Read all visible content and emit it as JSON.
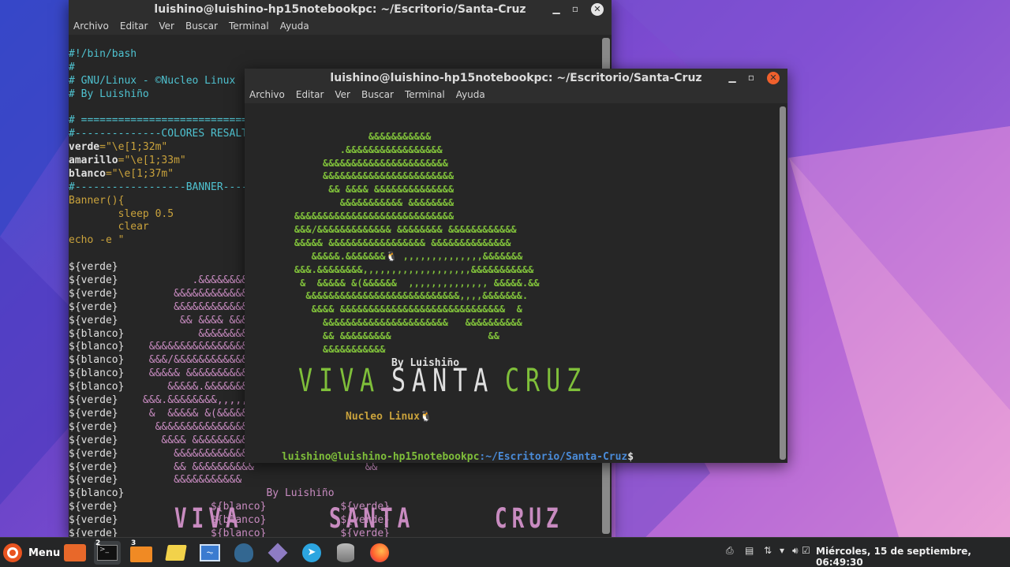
{
  "colors": {
    "accent": "#7fbf3a",
    "cyan": "#4fc2d0",
    "yellow": "#c9a23c",
    "pink": "#c88bc0",
    "prompt_blue": "#4a8bd8",
    "close_orange": "#f0602c"
  },
  "back_window": {
    "title": "luishino@luishino-hp15notebookpc: ~/Escritorio/Santa-Cruz",
    "menu": [
      "Archivo",
      "Editar",
      "Ver",
      "Buscar",
      "Terminal",
      "Ayuda"
    ],
    "lines": [
      "",
      "#!/bin/bash",
      "#",
      "# GNU/Linux - ©Nucleo Linux",
      "# By Luishiño",
      "",
      "# =====================================",
      "#--------------COLORES RESALTADOS",
      "verde=\"\\e[1;32m\"",
      "amarillo=\"\\e[1;33m\"",
      "blanco=\"\\e[1;37m\"",
      "#------------------BANNER-----",
      "Banner(){",
      "        sleep 0.5",
      "        clear",
      "echo -e \"",
      "",
      "${verde}",
      "${verde}            .&&&&&&&&&&&&",
      "${verde}         &&&&&&&&&&&&&&",
      "${verde}         &&&&&&&&&&&&&&",
      "${verde}          && &&&& &&&&",
      "${blanco}            &&&&&&&&&&&",
      "${blanco}    &&&&&&&&&&&&&&&&&&&&",
      "${blanco}    &&&/&&&&&&&&&&&&&&&&",
      "${blanco}    &&&&& &&&&&&&&&&&&&&",
      "${blanco}       &&&&&.&&&&&&&&&&&",
      "${verde}    &&&.&&&&&&&&,,,,,,,",
      "${verde}     &  &&&&& &(&&&&&&&",
      "${verde}      &&&&&&&&&&&&&&&&&&&",
      "${verde}       &&&& &&&&&&&&&&&&&",
      "${verde}         &&&&&&&&&&&&&&&&",
      "${verde}         && &&&&&&&&&&                  &&",
      "${verde}         &&&&&&&&&&&",
      "${blanco}                       By Luishiño",
      "${verde}               ${blanco}            ${verde}",
      "${verde}               ${blanco}            ${verde}",
      "${verde}               ${blanco}            ${verde}"
    ],
    "big_words": [
      "VIVA",
      "SANTA",
      "CRUZ"
    ]
  },
  "front_window": {
    "title": "luishino@luishino-hp15notebookpc: ~/Escritorio/Santa-Cruz",
    "menu": [
      "Archivo",
      "Editar",
      "Ver",
      "Buscar",
      "Terminal",
      "Ayuda"
    ],
    "art": [
      "",
      "",
      "                 &&&&&&&&&&&",
      "            .&&&&&&&&&&&&&&&&&",
      "         &&&&&&&&&&&&&&&&&&&&&&",
      "         &&&&&&&&&&&&&&&&&&&&&&&",
      "          && &&&& &&&&&&&&&&&&&&",
      "            &&&&&&&&&&& &&&&&&&&",
      "    &&&&&&&&&&&&&&&&&&&&&&&&&&&&",
      "    &&&/&&&&&&&&&&&&& &&&&&&&& &&&&&&&&&&&&",
      "    &&&&& &&&&&&&&&&&&&&&&& &&&&&&&&&&&&&&",
      "       &&&&&.&&&&&&&🐧 ,,,,,,,,,,,,,,&&&&&&&",
      "    &&&.&&&&&&&&,,,,,,,,,,,,,,,,,,,&&&&&&&&&&&",
      "     &  &&&&& &(&&&&&&  ,,,,,,,,,,,,,, &&&&&.&&",
      "      &&&&&&&&&&&&&&&&&&&&&&&&&&&,,,,&&&&&&&.",
      "       &&&& &&&&&&&&&&&&&&&&&&&&&&&&&&&&&  &",
      "         &&&&&&&&&&&&&&&&&&&&&&   &&&&&&&&&&",
      "         && &&&&&&&&&                 &&",
      "         &&&&&&&&&&&"
    ],
    "byline": "By Luishiño",
    "big_words": [
      "VIVA",
      "SANTA",
      "CRUZ"
    ],
    "nucleo": "Nucleo Linux🐧",
    "prompt_user": "luishino@luishino-hp15notebookpc",
    "prompt_path": ":~/Escritorio/Santa-Cruz",
    "prompt_symbol": "$"
  },
  "taskbar": {
    "menu_label": "Menu",
    "badges": [
      "2",
      "3"
    ],
    "icons": [
      "ubuntu-logo-icon",
      "file-manager-icon",
      "terminal-icon",
      "folder-icon",
      "text-editor-icon",
      "system-monitor-icon",
      "postgres-elephant-icon",
      "package-cube-icon",
      "telegram-icon",
      "database-icon",
      "firefox-icon"
    ],
    "tray_icons": [
      "printer-icon",
      "clipboard-icon",
      "network-icon",
      "wifi-icon",
      "volume-icon",
      "check-icon"
    ],
    "clock": "Miércoles, 15 de septiembre, 06:49:30"
  }
}
